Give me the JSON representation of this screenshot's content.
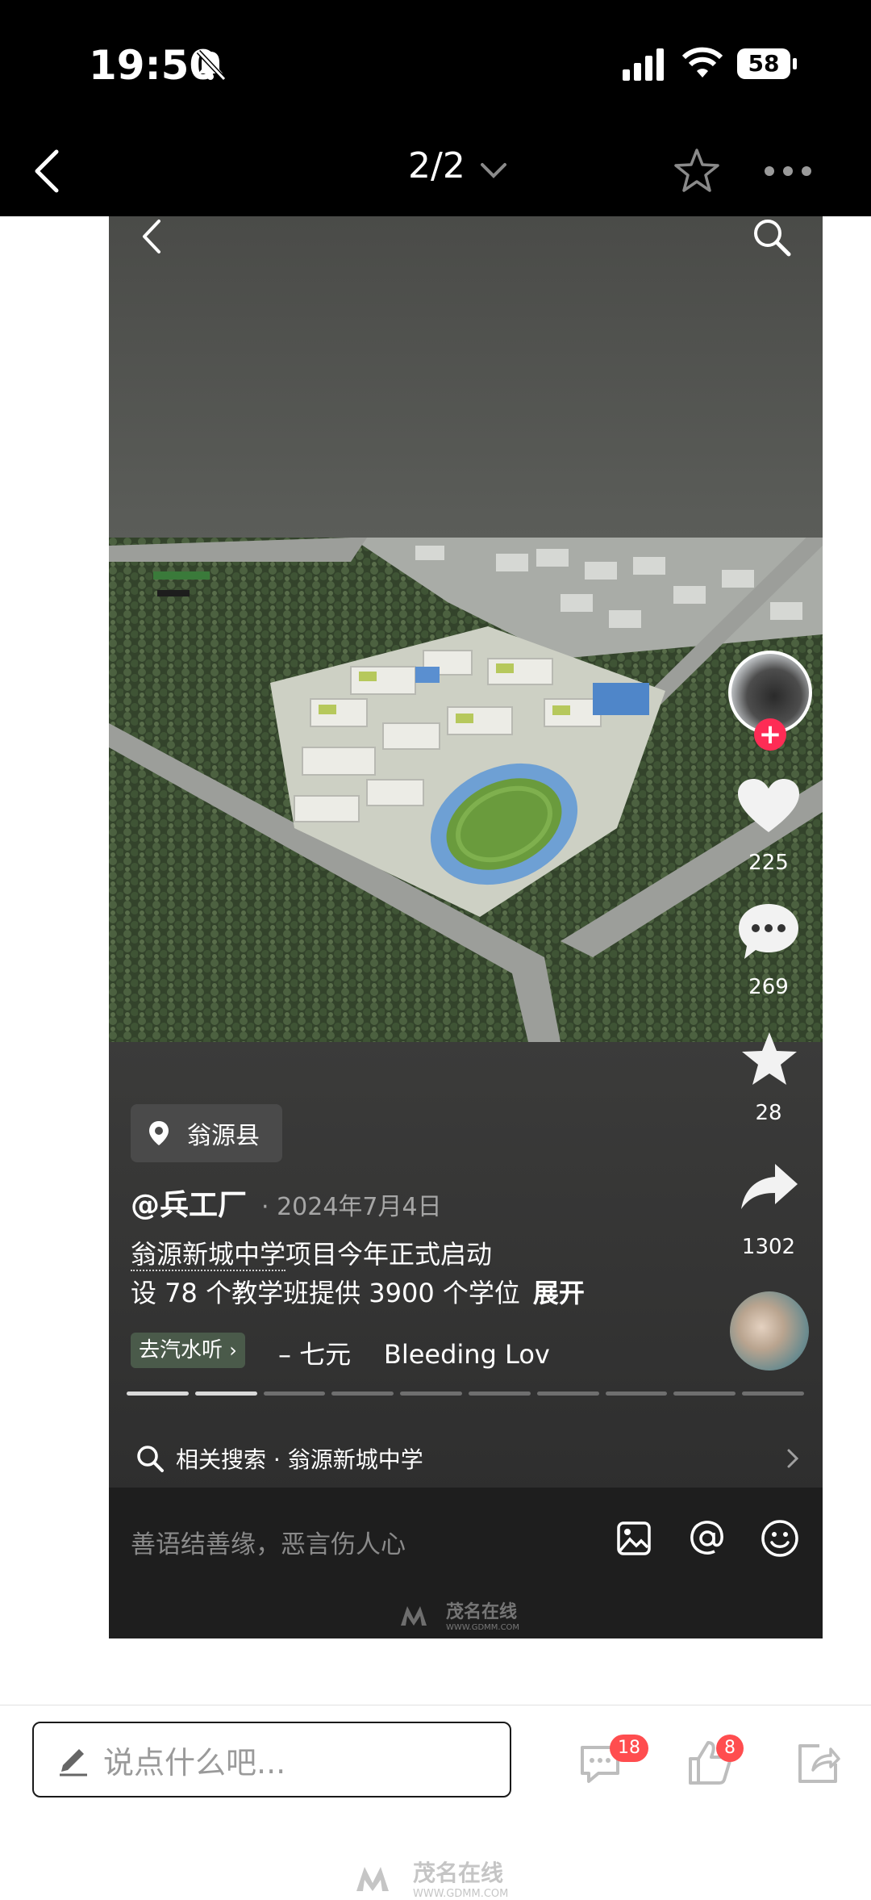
{
  "status_bar": {
    "time": "19:50",
    "battery": "58"
  },
  "nav": {
    "page_indicator": "2/2"
  },
  "embedded": {
    "location_tag": "翁源县",
    "author": "@兵工厂",
    "date": "· 2024年7月4日",
    "caption_line1_highlight": "翁源新城中学",
    "caption_line1_rest": "项目今年正式启动",
    "caption_line2": "设 78 个教学班提供 3900 个学位",
    "expand_label": "展开",
    "music_chip": "去汽水听",
    "music_text": "– 七元    Bleeding Lov",
    "rail": {
      "likes": "225",
      "comments": "269",
      "favorites": "28",
      "shares": "1302"
    },
    "related_search": "相关搜索 · 翁源新城中学",
    "comment_placeholder": "善语结善缘，恶言伤人心",
    "watermark": "茂名在线",
    "watermark_url": "WWW.GDMM.COM"
  },
  "bottom": {
    "comment_placeholder": "说点什么吧...",
    "comment_badge": "18",
    "like_badge": "8",
    "watermark": "茂名在线",
    "watermark_url": "WWW.GDMM.COM"
  },
  "colors": {
    "accent_red": "#fe2c55",
    "badge_red": "#ff4d4f"
  }
}
